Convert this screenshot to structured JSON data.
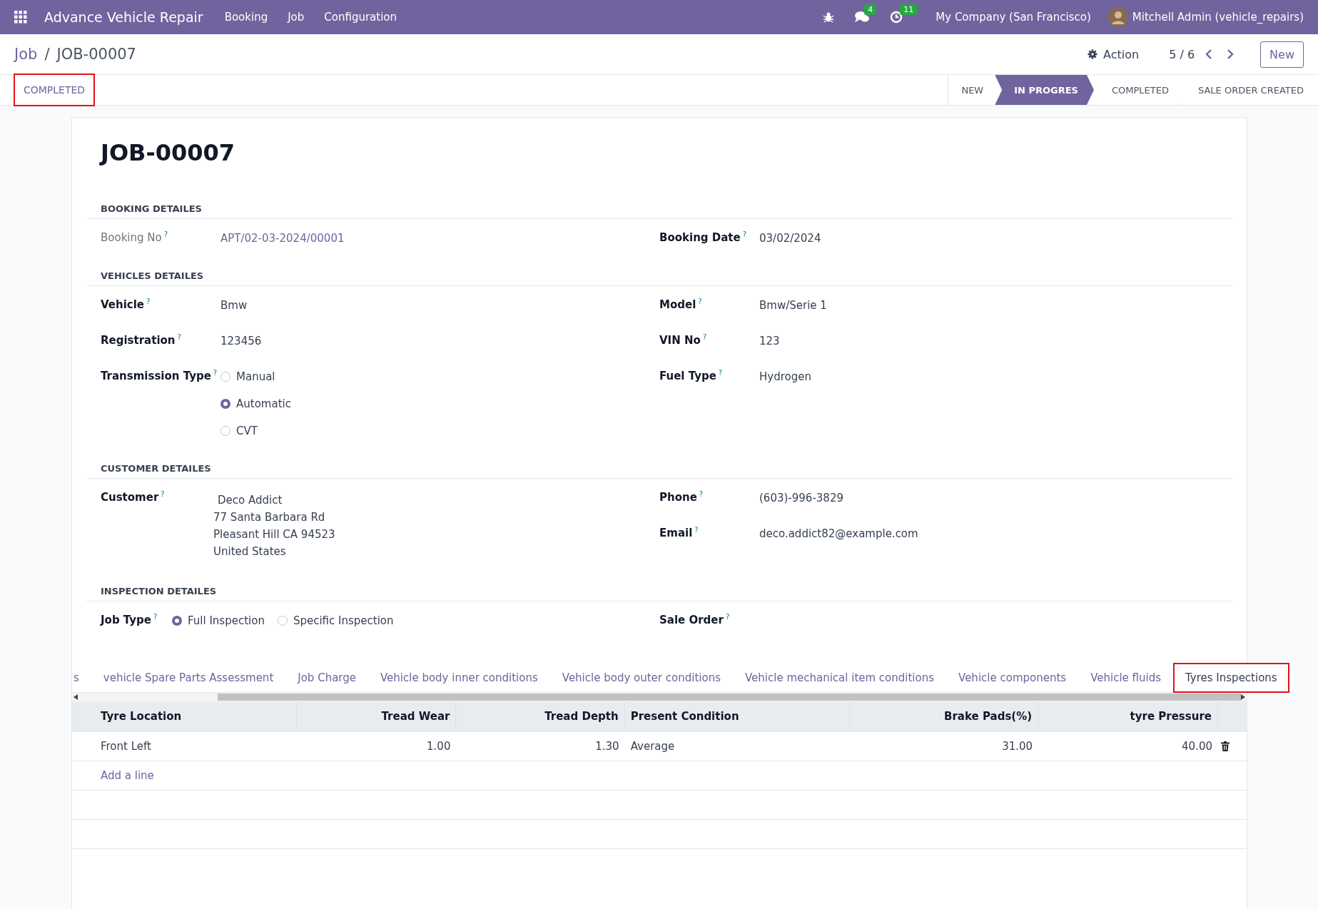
{
  "navbar": {
    "app_name": "Advance Vehicle Repair",
    "menus": [
      "Booking",
      "Job",
      "Configuration"
    ],
    "messages_badge": "4",
    "activities_badge": "11",
    "company": "My Company (San Francisco)",
    "user": "Mitchell Admin (vehicle_repairs)"
  },
  "breadcrumb": {
    "parent": "Job",
    "separator": "/",
    "current": "JOB-00007"
  },
  "action": "Action",
  "pager": "5 / 6",
  "new_button": "New",
  "status_button": {
    "label": "COMPLETED",
    "highlighted": true
  },
  "stages": [
    {
      "label": "NEW",
      "selected": false
    },
    {
      "label": "IN PROGRES",
      "selected": true
    },
    {
      "label": "COMPLETED",
      "selected": false
    },
    {
      "label": "SALE ORDER CREATED",
      "selected": false
    }
  ],
  "title": "JOB-00007",
  "sections": [
    {
      "title": "BOOKING DETAILES",
      "left": [
        {
          "label": "Booking No",
          "help": "?",
          "kind": "link",
          "value": "APT/02-03-2024/00001",
          "muted": true
        }
      ],
      "right": [
        {
          "label": "Booking Date",
          "help": "?",
          "kind": "text",
          "value": "03/02/2024"
        }
      ]
    },
    {
      "title": "VEHICLES DETAILES",
      "left": [
        {
          "label": "Vehicle",
          "help": "?",
          "kind": "text",
          "value": "Bmw"
        },
        {
          "label": "Registration",
          "help": "?",
          "kind": "text",
          "value": "123456"
        },
        {
          "label": "Transmission Type",
          "help": "?",
          "kind": "radio",
          "options": [
            {
              "label": "Manual",
              "selected": false
            },
            {
              "label": "Automatic",
              "selected": true
            },
            {
              "label": "CVT",
              "selected": false
            }
          ]
        }
      ],
      "right": [
        {
          "label": "Model",
          "help": "?",
          "kind": "text",
          "value": "Bmw/Serie 1"
        },
        {
          "label": "VIN No",
          "help": "?",
          "kind": "text",
          "value": "123"
        },
        {
          "label": "Fuel Type",
          "help": "?",
          "kind": "text",
          "value": "Hydrogen"
        }
      ]
    },
    {
      "title": "CUSTOMER DETAILES",
      "left": [
        {
          "label": "Customer",
          "help": "?",
          "kind": "address",
          "lines": [
            "Deco Addict",
            "77 Santa Barbara Rd",
            "Pleasant Hill CA 94523",
            "United States"
          ]
        }
      ],
      "right": [
        {
          "label": "Phone",
          "help": "?",
          "kind": "text",
          "value": "(603)-996-3829"
        },
        {
          "label": "Email",
          "help": "?",
          "kind": "text",
          "value": "deco.addict82@example.com"
        }
      ]
    },
    {
      "title": "INSPECTION DETAILES",
      "left": [
        {
          "label": "Job Type",
          "help": "?",
          "kind": "inline-radio",
          "options": [
            {
              "label": "Full Inspection",
              "selected": true
            },
            {
              "label": "Specific Inspection",
              "selected": false
            }
          ]
        }
      ],
      "right": [
        {
          "label": "Sale Order",
          "help": "?",
          "kind": "empty"
        }
      ]
    }
  ],
  "tabs": [
    {
      "label": "s",
      "selected": false,
      "highlighted": false
    },
    {
      "label": "vehicle Spare Parts Assessment",
      "selected": false,
      "highlighted": false
    },
    {
      "label": "Job Charge",
      "selected": false,
      "highlighted": false
    },
    {
      "label": "Vehicle body inner conditions",
      "selected": false,
      "highlighted": false
    },
    {
      "label": "Vehicle body outer conditions",
      "selected": false,
      "highlighted": false
    },
    {
      "label": "Vehicle mechanical item conditions",
      "selected": false,
      "highlighted": false
    },
    {
      "label": "Vehicle components",
      "selected": false,
      "highlighted": false
    },
    {
      "label": "Vehicle fluids",
      "selected": false,
      "highlighted": false
    },
    {
      "label": "Tyres Inspections",
      "selected": true,
      "highlighted": true
    }
  ],
  "table": {
    "columns": [
      {
        "label": "Tyre Location",
        "kind": "text"
      },
      {
        "label": "Tread Wear",
        "kind": "number"
      },
      {
        "label": "Tread Depth",
        "kind": "number"
      },
      {
        "label": "Present Condition",
        "kind": "text"
      },
      {
        "label": "Brake Pads(%)",
        "kind": "number"
      },
      {
        "label": "tyre Pressure",
        "kind": "number"
      }
    ],
    "rows": [
      {
        "cells": [
          "Front Left",
          "1.00",
          "1.30",
          "Average",
          "31.00",
          "40.00"
        ],
        "deletable": true
      }
    ],
    "add_line": "Add a line"
  }
}
